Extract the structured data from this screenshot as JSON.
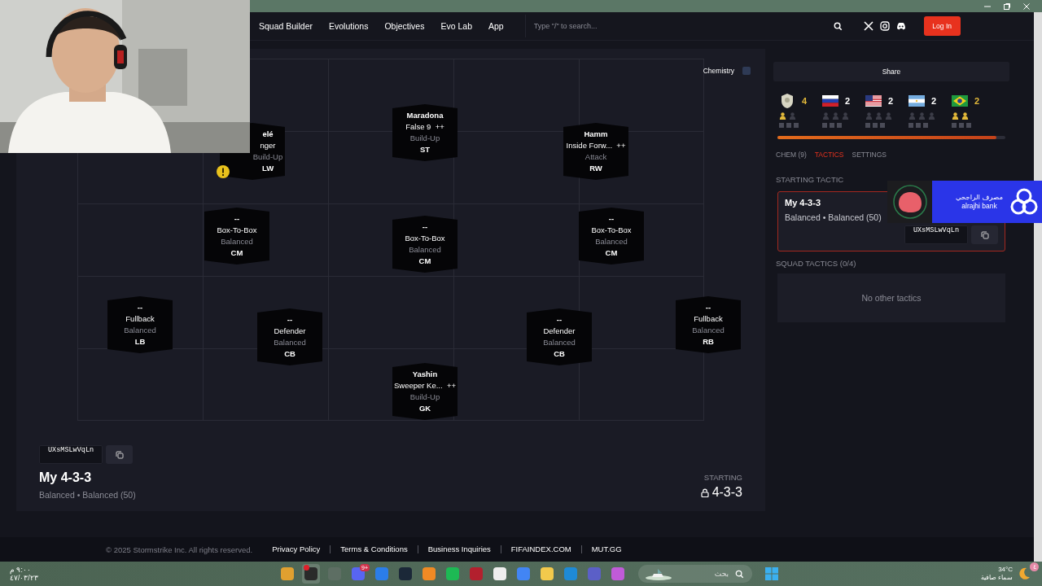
{
  "window_controls": {
    "buttons": [
      {
        "kind": "minimize"
      },
      {
        "kind": "restore"
      },
      {
        "kind": "close"
      }
    ]
  },
  "nav": {
    "links": [
      {
        "label": "Squad Builder"
      },
      {
        "label": "Evolutions"
      },
      {
        "label": "Objectives"
      },
      {
        "label": "Evo Lab"
      },
      {
        "label": "App"
      }
    ],
    "search": {
      "placeholder": "Type \"/\" to search..."
    },
    "socials": [
      {
        "kind": "x"
      },
      {
        "kind": "instagram"
      },
      {
        "kind": "discord"
      }
    ],
    "login": "Log In"
  },
  "pitch": {
    "chemistry_toggle": {
      "label": "Chemistry",
      "on": false
    },
    "players": [
      {
        "name": "elé",
        "role": "nger",
        "style": "Build-Up",
        "position": "LW",
        "warning": true
      },
      {
        "name": "Maradona",
        "role": "False 9",
        "plus": "++",
        "style": "Build-Up",
        "position": "ST",
        "warning": false
      },
      {
        "name": "Hamm",
        "role": "Inside Forw...",
        "plus": "++",
        "style": "Attack",
        "position": "RW",
        "warning": false
      },
      {
        "name": "--",
        "role": "Box-To-Box",
        "style": "Balanced",
        "position": "CM",
        "warning": false
      },
      {
        "name": "--",
        "role": "Box-To-Box",
        "style": "Balanced",
        "position": "CM",
        "warning": false
      },
      {
        "name": "--",
        "role": "Box-To-Box",
        "style": "Balanced",
        "position": "CM",
        "warning": false
      },
      {
        "name": "--",
        "role": "Fullback",
        "style": "Balanced",
        "position": "LB",
        "warning": false
      },
      {
        "name": "--",
        "role": "Defender",
        "style": "Balanced",
        "position": "CB",
        "warning": false
      },
      {
        "name": "--",
        "role": "Defender",
        "style": "Balanced",
        "position": "CB",
        "warning": false
      },
      {
        "name": "--",
        "role": "Fullback",
        "style": "Balanced",
        "position": "RB",
        "warning": false
      },
      {
        "name": "Yashin",
        "role": "Sweeper Ke...",
        "plus": "++",
        "style": "Build-Up",
        "position": "GK",
        "warning": false
      }
    ]
  },
  "squad": {
    "code": "UXsMSLwVqLn",
    "name": "My 4-3-3",
    "tactic": "Balanced • Balanced (50)",
    "formation_label": "STARTING",
    "formation": "4-3-3",
    "locked": true
  },
  "side": {
    "share": "Share",
    "nations": [
      {
        "kind": "icon",
        "count": "4",
        "active": true,
        "markers": [
          {
            "on": true
          },
          {
            "on": false
          }
        ]
      },
      {
        "kind": "russia",
        "count": "2",
        "active": false,
        "markers": [
          {
            "on": false
          },
          {
            "on": false
          },
          {
            "on": false
          }
        ]
      },
      {
        "kind": "usa",
        "count": "2",
        "active": false,
        "markers": [
          {
            "on": false
          },
          {
            "on": false
          },
          {
            "on": false
          }
        ]
      },
      {
        "kind": "argentina",
        "count": "2",
        "active": false,
        "markers": [
          {
            "on": false
          },
          {
            "on": false
          },
          {
            "on": false
          }
        ]
      },
      {
        "kind": "brazil",
        "count": "2",
        "active": true,
        "markers": [
          {
            "on": true
          },
          {
            "on": true
          }
        ]
      }
    ],
    "chemistry_bar": {
      "level": 0.96
    },
    "tabs": [
      {
        "label": "CHEM (9)",
        "selected": false
      },
      {
        "label": "TACTICS",
        "selected": true
      },
      {
        "label": "SETTINGS",
        "selected": false
      }
    ],
    "starting_tactic": {
      "heading": "STARTING TACTIC",
      "name": "My 4-3-3",
      "tactic": "Balanced • Balanced (50)",
      "code": "UXsMSLwVqLn"
    },
    "squad_tactics": {
      "heading": "SQUAD TACTICS (0/4)",
      "empty": "No other tactics"
    }
  },
  "sponsor": {
    "arabic_name": "مصرف الراجحي",
    "name": "alrajhi bank"
  },
  "footer": {
    "copyright": "© 2025 Stormstrike Inc. All rights reserved.",
    "links": [
      {
        "label": "Privacy Policy"
      },
      {
        "label": "Terms & Conditions"
      },
      {
        "label": "Business Inquiries"
      },
      {
        "label": "FIFAINDEX.COM"
      },
      {
        "label": "MUT.GG"
      }
    ]
  },
  "taskbar": {
    "time": "٩:٠٠ م",
    "date": "٤٧/٠٣/٢٣",
    "apps": [
      {
        "color": "#e0a030",
        "selected": false
      },
      {
        "color": "#2a2a2a",
        "selected": true,
        "alert": true
      },
      {
        "color": "#5d6e63",
        "selected": false
      },
      {
        "color": "#5865f2",
        "selected": false,
        "badge": "9+"
      },
      {
        "color": "#2b7de9",
        "selected": false
      },
      {
        "color": "#1b2838",
        "selected": false
      },
      {
        "color": "#f08a24",
        "selected": false
      },
      {
        "color": "#1db954",
        "selected": false
      },
      {
        "color": "#b3202e",
        "selected": false
      },
      {
        "color": "#eeeeee",
        "selected": false
      },
      {
        "color": "#4285f4",
        "selected": false
      },
      {
        "color": "#f2c94c",
        "selected": false
      },
      {
        "color": "#1e8ad6",
        "selected": false
      },
      {
        "color": "#5b5fc7",
        "selected": false
      },
      {
        "color": "#c05bd8",
        "selected": false
      }
    ],
    "search": {
      "placeholder": "بحث"
    },
    "weather": {
      "temperature": "34°C",
      "condition": "سماء صافية",
      "badge": "٤"
    }
  }
}
